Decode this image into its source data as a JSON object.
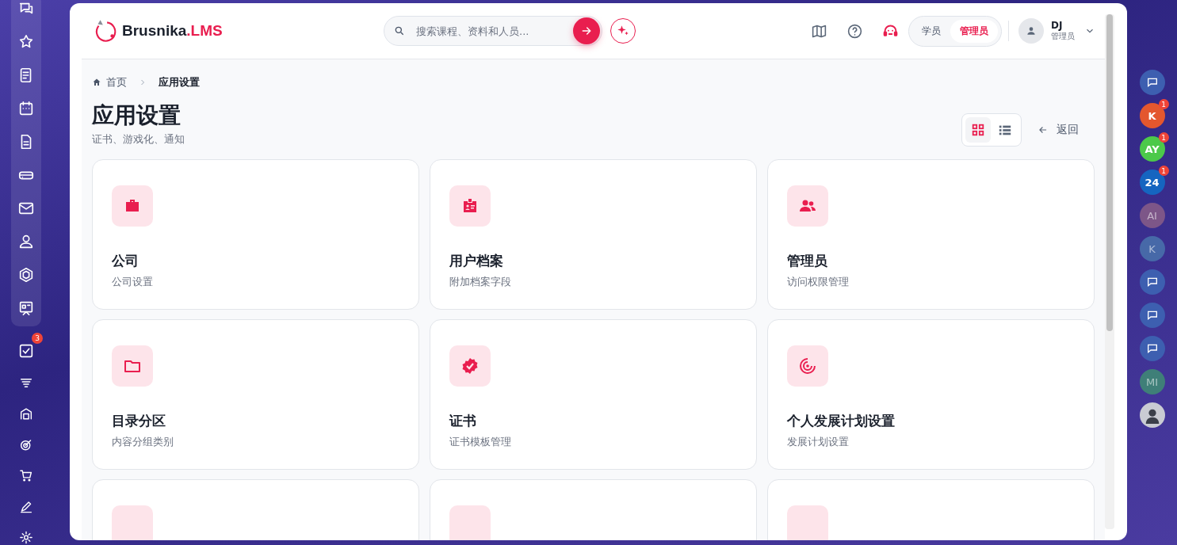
{
  "brand": {
    "name": "Brusnika",
    "suffix": ".LMS"
  },
  "search": {
    "placeholder": "搜索课程、资料和人员..."
  },
  "role_switch": [
    {
      "label": "学员",
      "selected": false
    },
    {
      "label": "管理员",
      "selected": true
    }
  ],
  "user": {
    "initials": "DJ",
    "role": "管理员"
  },
  "sidebar": {
    "tasks_badge": "3"
  },
  "breadcrumb": {
    "home": "首页",
    "current": "应用设置"
  },
  "page": {
    "title": "应用设置",
    "subtitle": "证书、游戏化、通知",
    "back": "返回"
  },
  "view_modes": [
    {
      "kind": "grid",
      "selected": true
    },
    {
      "kind": "list",
      "selected": false
    }
  ],
  "cards": [
    {
      "kind": "briefcase",
      "title": "公司",
      "description": "公司设置"
    },
    {
      "kind": "id-card",
      "title": "用户档案",
      "description": "附加档案字段"
    },
    {
      "kind": "people",
      "title": "管理员",
      "description": "访问权限管理"
    },
    {
      "kind": "folder",
      "title": "目录分区",
      "description": "内容分组类别"
    },
    {
      "kind": "badge",
      "title": "证书",
      "description": "证书模板管理"
    },
    {
      "kind": "target",
      "title": "个人发展计划设置",
      "description": "发展计划设置"
    },
    {
      "kind": "partial"
    },
    {
      "kind": "partial"
    },
    {
      "kind": "partial"
    }
  ],
  "dock": [
    {
      "kind": "icon"
    },
    {
      "kind": "initials",
      "label": "K",
      "color": "#e4572e",
      "badge": "1",
      "dimmed": false
    },
    {
      "kind": "initials",
      "label": "AY",
      "color": "#4cc94a",
      "badge": "1",
      "dimmed": false
    },
    {
      "kind": "initials",
      "label": "24",
      "color": "#1565c0",
      "badge": "1",
      "dimmed": false
    },
    {
      "kind": "initials",
      "label": "AI",
      "color": "#7d5688",
      "dimmed": true
    },
    {
      "kind": "initials",
      "label": "K",
      "color": "#4769a8",
      "dimmed": true
    },
    {
      "kind": "icon"
    },
    {
      "kind": "icon"
    },
    {
      "kind": "icon"
    },
    {
      "kind": "initials",
      "label": "MI",
      "color": "#3f7f78",
      "dimmed": true
    },
    {
      "kind": "avatar"
    }
  ]
}
